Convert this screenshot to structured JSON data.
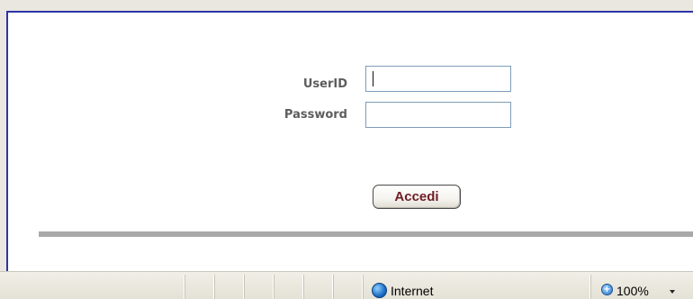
{
  "login_form": {
    "userid_label": "UserID",
    "userid_value": "",
    "userid_placeholder": "",
    "password_label": "Password",
    "password_value": "",
    "password_placeholder": "",
    "submit_label": "Accedi"
  },
  "status_bar": {
    "zone_label": "Internet",
    "zoom_level": "100%",
    "zone_icon": "globe-icon",
    "zoom_icon": "magnifier-icon",
    "dropdown_icon": "chevron-down-icon"
  },
  "colors": {
    "frame_border": "#2c34a6",
    "button_text": "#6e1d23",
    "label_text": "#5d5d5d",
    "divider": "#a9a9a9",
    "status_bar": "#e9e7df"
  }
}
